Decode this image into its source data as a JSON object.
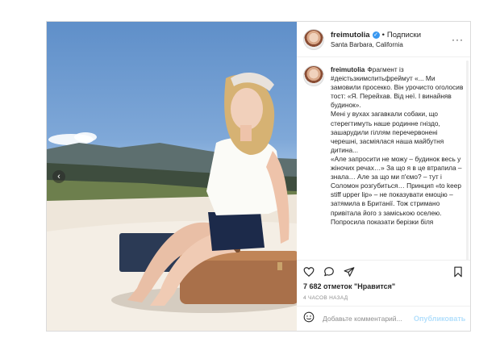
{
  "post": {
    "username": "freimutolia",
    "follow_label": "Подписки",
    "location": "Santa Barbara, California",
    "caption": "Фрагмент із #деістьзкимспитьфреймут «... Ми замовили просекко. Він урочисто оголосив тост: «Я. Перейхав. Від неї. І винайняв будинок».\nМені у вухах загавкали собаки, що стерегтимуть наше родинне гніздо, зашарудили гіллям перечервонені черешні, засміялася наша майбутня дитина...\n«Але запросити не можу – будинок весь у жіночих речах…» За що я в це втрапила – знала… Але за що ми п'ємо? – тут і Соломон розгубиться… Принцип «to keep stiff upper lip» – не показувати емоцію – затямила в Британії. Тож стримано привітала його з заміською оселею.\nПопросила показати берізки біля",
    "likes": "7 682 отметок \"Нравится\"",
    "time": "4 ЧАСОВ НАЗАД",
    "comment_placeholder": "Добавьте комментарий...",
    "publish_label": "Опубликовать"
  },
  "icons": {
    "prev": "chevron-left-icon",
    "more": "more-options-icon",
    "like": "heart-icon",
    "comment": "comment-icon",
    "share": "share-icon",
    "save": "bookmark-icon",
    "emoji": "emoji-icon"
  },
  "colors": {
    "accent": "#3897f0",
    "publish_disabled": "#b2dffc",
    "border": "#dbdbdb"
  }
}
